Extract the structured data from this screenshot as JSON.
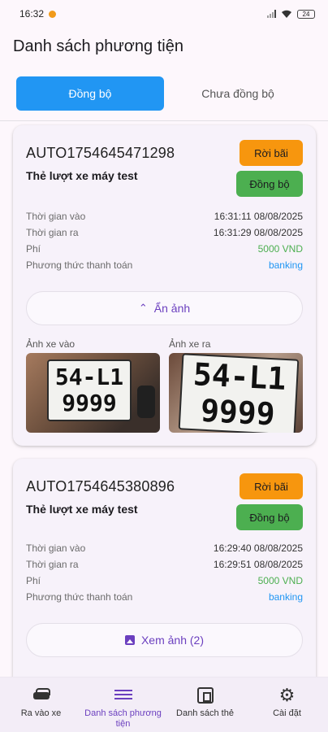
{
  "status_bar": {
    "time": "16:32",
    "battery": "24"
  },
  "header": {
    "title": "Danh sách phương tiện"
  },
  "tabs": [
    {
      "label": "Đồng bộ",
      "active": true
    },
    {
      "label": "Chưa đồng bộ",
      "active": false
    }
  ],
  "cards": [
    {
      "code": "AUTO1754645471298",
      "name": "Thẻ lượt xe máy test",
      "exit_button": "Rời bãi",
      "sync_button": "Đồng bộ",
      "rows": [
        {
          "label": "Thời gian vào",
          "value": "16:31:11 08/08/2025"
        },
        {
          "label": "Thời gian ra",
          "value": "16:31:29 08/08/2025"
        },
        {
          "label": "Phí",
          "value": "5000 VND"
        },
        {
          "label": "Phương thức thanh toán",
          "value": "banking"
        }
      ],
      "toggle_label": "Ẩn ảnh",
      "photo_in_label": "Ảnh xe vào",
      "photo_out_label": "Ảnh xe ra",
      "plate_top": "54-L1",
      "plate_bottom": "9999"
    },
    {
      "code": "AUTO1754645380896",
      "name": "Thẻ lượt xe máy test",
      "exit_button": "Rời bãi",
      "sync_button": "Đồng bộ",
      "rows": [
        {
          "label": "Thời gian vào",
          "value": "16:29:40 08/08/2025"
        },
        {
          "label": "Thời gian ra",
          "value": "16:29:51 08/08/2025"
        },
        {
          "label": "Phí",
          "value": "5000 VND"
        },
        {
          "label": "Phương thức thanh toán",
          "value": "banking"
        }
      ],
      "toggle_label": "Xem ảnh (2)"
    }
  ],
  "bottom_nav": [
    {
      "label": "Ra vào xe",
      "icon": "car-icon"
    },
    {
      "label": "Danh sách phương tiện",
      "icon": "list-icon",
      "active": true
    },
    {
      "label": "Danh sách thẻ",
      "icon": "card-icon"
    },
    {
      "label": "Cài đặt",
      "icon": "gear-icon"
    }
  ],
  "colors": {
    "tab_active": "#2196f3",
    "exit_button": "#f7960e",
    "sync_button": "#4caf50",
    "fee": "#4caf50",
    "payment": "#2196f3",
    "accent": "#6b3fbf"
  }
}
